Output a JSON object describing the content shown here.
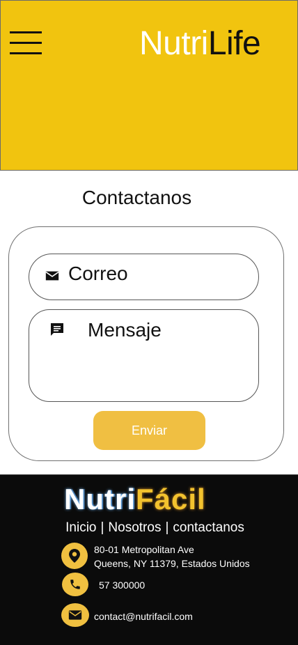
{
  "header": {
    "brand_part1": "Nutri",
    "brand_part2": "Life",
    "bg_color": "#f1c40f"
  },
  "contact": {
    "title": "Contactanos",
    "email_placeholder": "Correo",
    "message_placeholder": "Mensaje",
    "send_label": "Enviar",
    "button_color": "#f0bf42"
  },
  "footer": {
    "logo_part1": "Nutri",
    "logo_part2": "Fácil",
    "nav": {
      "home": "Inicio",
      "about": "Nosotros",
      "contact": "contactanos",
      "separator": "|"
    },
    "address_line1": "80-01 Metropolitan Ave",
    "address_line2": "Queens, NY 11379, Estados Unidos",
    "phone": "57 300000",
    "email": "contact@nutrifacil.com",
    "icon_color": "#f0c040"
  },
  "icons": {
    "menu": "hamburger-menu-icon",
    "email": "envelope-icon",
    "message": "chat-bubble-icon",
    "location": "location-pin-icon",
    "phone": "phone-icon"
  }
}
